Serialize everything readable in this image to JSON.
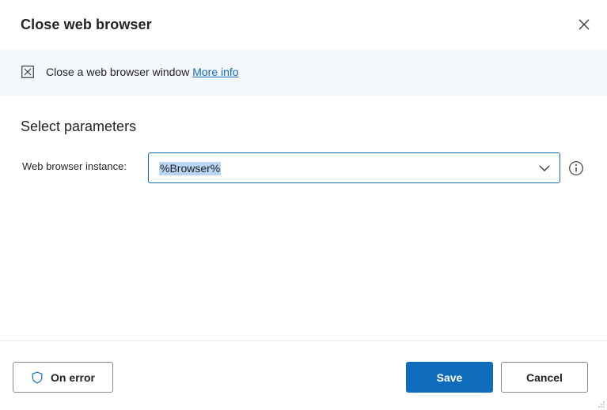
{
  "dialog": {
    "title": "Close web browser",
    "close_icon": "close-icon"
  },
  "info": {
    "icon": "close-window-action-icon",
    "description": "Close a web browser window",
    "more_info_link": "More info"
  },
  "parameters": {
    "section_title": "Select parameters",
    "web_browser_instance": {
      "label": "Web browser instance:",
      "value": "%Browser%",
      "dropdown_icon": "chevron-down-icon",
      "info_icon": "info-icon"
    }
  },
  "footer": {
    "on_error_label": "On error",
    "on_error_icon": "shield-icon",
    "save_label": "Save",
    "cancel_label": "Cancel"
  },
  "colors": {
    "accent": "#0f6cbd",
    "info_band": "#f4f7fc",
    "selection": "#b9d5f5"
  }
}
